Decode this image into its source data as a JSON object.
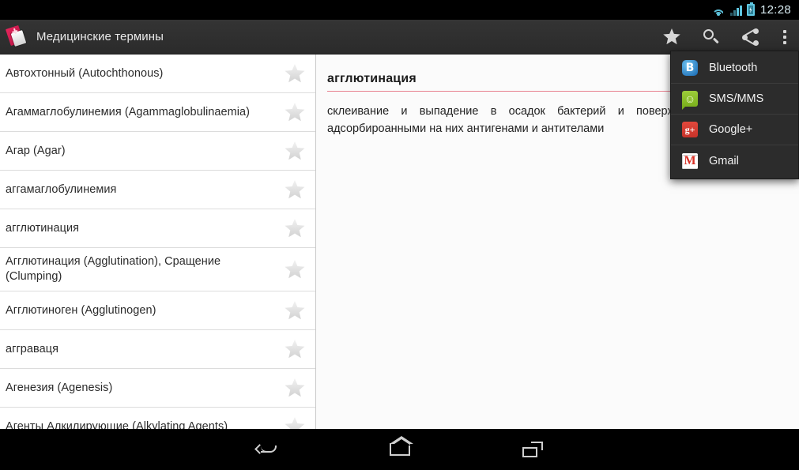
{
  "statusbar": {
    "clock": "12:28",
    "icons": [
      "wifi-icon",
      "signal-icon",
      "battery-charging-icon"
    ]
  },
  "actionbar": {
    "app_icon": "medical-book-icon",
    "title": "Медицинские термины",
    "actions": [
      {
        "name": "favorites-button",
        "icon": "star-icon"
      },
      {
        "name": "search-button",
        "icon": "search-icon"
      },
      {
        "name": "share-button",
        "icon": "share-icon"
      },
      {
        "name": "overflow-button",
        "icon": "overflow-menu-icon"
      }
    ]
  },
  "list": {
    "items": [
      {
        "label": "Автохтонный (Autochthonous)",
        "fav_icon": "star-outline-icon"
      },
      {
        "label": "Агаммаглобулинемия (Agammaglobulinaemia)",
        "fav_icon": "star-outline-icon"
      },
      {
        "label": "Агар (Agar)",
        "fav_icon": "star-outline-icon"
      },
      {
        "label": "аггамаглобулинемия",
        "fav_icon": "star-outline-icon"
      },
      {
        "label": "агглютинация",
        "fav_icon": "star-outline-icon"
      },
      {
        "label": "Агглютинация (Agglutination), Сращение (Clumping)",
        "fav_icon": "star-outline-icon"
      },
      {
        "label": "Агглютиноген (Agglutinogen)",
        "fav_icon": "star-outline-icon"
      },
      {
        "label": "агграваця",
        "fav_icon": "star-outline-icon"
      },
      {
        "label": "Агенезия (Agenesis)",
        "fav_icon": "star-outline-icon"
      },
      {
        "label": "Агенты Алкилирующие (Alkylating Agents)",
        "fav_icon": "star-outline-icon"
      }
    ]
  },
  "detail": {
    "title": "агглютинация",
    "body": "склеивание и выпадение в осадок бактерий и поверхностных частиц с адсорбироанными на них антигенами и антителами"
  },
  "share_menu": {
    "items": [
      {
        "label": "Bluetooth",
        "icon": "bluetooth-icon"
      },
      {
        "label": "SMS/MMS",
        "icon": "sms-icon"
      },
      {
        "label": "Google+",
        "icon": "google-plus-icon"
      },
      {
        "label": "Gmail",
        "icon": "gmail-icon"
      }
    ]
  },
  "navbar": {
    "buttons": [
      {
        "name": "back-button",
        "icon": "back-icon"
      },
      {
        "name": "home-button",
        "icon": "home-icon"
      },
      {
        "name": "recents-button",
        "icon": "recent-apps-icon"
      }
    ]
  },
  "colors": {
    "accent_underline": "#e8808f",
    "actionbar_bg": "#2f2f2f",
    "status_icon": "#5fc6e0"
  }
}
